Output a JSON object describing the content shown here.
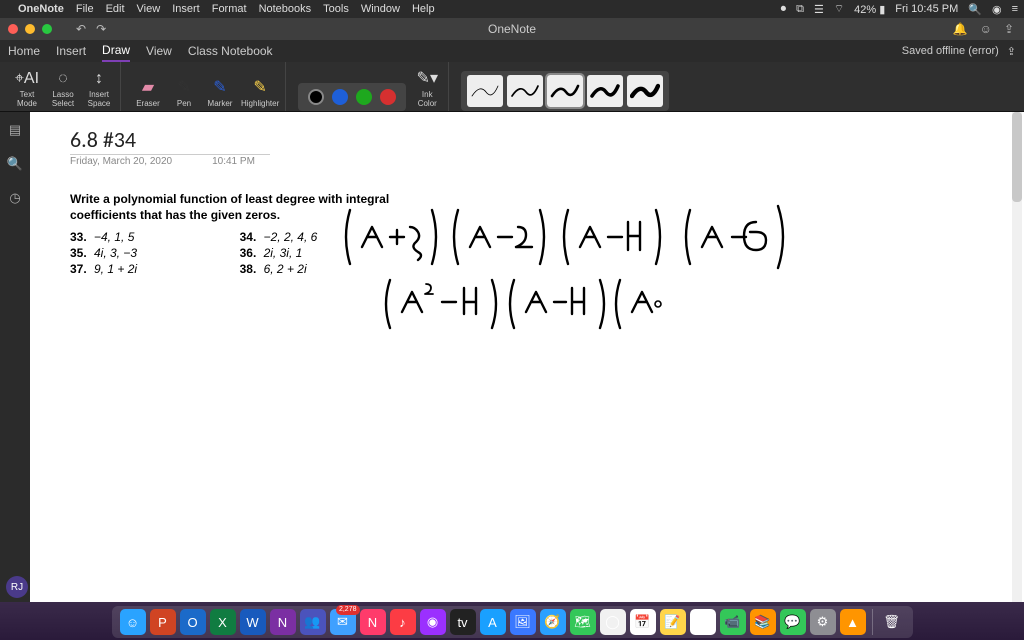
{
  "menubar": {
    "app": "OneNote",
    "items": [
      "File",
      "Edit",
      "View",
      "Insert",
      "Format",
      "Notebooks",
      "Tools",
      "Window",
      "Help"
    ],
    "status": {
      "battery": "42%",
      "clock": "Fri 10:45 PM"
    }
  },
  "titlebar": {
    "title": "OneNote",
    "undo": "↶",
    "redo": "↷",
    "bell": "🔔",
    "face": "☺",
    "share": "⇪"
  },
  "ribbon_tabs": [
    "Home",
    "Insert",
    "Draw",
    "View",
    "Class Notebook"
  ],
  "ribbon_active": "Draw",
  "save_status": "Saved offline (error)",
  "tools": {
    "text_mode": "Text\nMode",
    "lasso": "Lasso\nSelect",
    "insert_space": "Insert\nSpace",
    "eraser": "Eraser",
    "pen": "Pen",
    "marker": "Marker",
    "highlighter": "Highlighter",
    "ink_color": "Ink\nColor"
  },
  "colors": {
    "black": "#000000",
    "blue": "#1e5fd8",
    "green": "#1ea81e",
    "red": "#d63030"
  },
  "strokes": [
    "0.25 mm",
    "0.35 mm",
    "0.5 mm",
    "0.7 mm",
    "1 mm"
  ],
  "stroke_selected": 2,
  "page": {
    "title": "6.8 #34",
    "date": "Friday, March 20, 2020",
    "time": "10:41 PM",
    "stem": "Write a polynomial function of least degree with integral coefficients that has the given zeros.",
    "items_left": [
      {
        "n": "33.",
        "v": "−4, 1, 5"
      },
      {
        "n": "35.",
        "v": "4i, 3, −3"
      },
      {
        "n": "37.",
        "v": "9, 1 + 2i"
      }
    ],
    "items_right": [
      {
        "n": "34.",
        "v": "−2, 2, 4, 6"
      },
      {
        "n": "36.",
        "v": "2i, 3i, 1"
      },
      {
        "n": "38.",
        "v": "6, 2 + 2i"
      }
    ],
    "ink_line1": "( x + 2 ) ( x − 2 ) ( x − 4 ) ( x − 6 )",
    "ink_line2": "( x² − 4 ) ( x − 4 ) ( x"
  },
  "avatar": "RJ",
  "dock": {
    "apps": [
      {
        "name": "finder",
        "color": "#2aa3ff",
        "glyph": "☺"
      },
      {
        "name": "powerpoint",
        "color": "#d04423",
        "glyph": "P"
      },
      {
        "name": "outlook",
        "color": "#1b6ac9",
        "glyph": "O"
      },
      {
        "name": "excel",
        "color": "#107c41",
        "glyph": "X"
      },
      {
        "name": "word",
        "color": "#185abd",
        "glyph": "W"
      },
      {
        "name": "onenote",
        "color": "#7b2fa3",
        "glyph": "N"
      },
      {
        "name": "teams",
        "color": "#4b53bc",
        "glyph": "👥"
      },
      {
        "name": "mail",
        "color": "#3fa0ff",
        "glyph": "✉",
        "badge": "2,278"
      },
      {
        "name": "news",
        "color": "#ff3b6b",
        "glyph": "N"
      },
      {
        "name": "music",
        "color": "#fc3c44",
        "glyph": "♪"
      },
      {
        "name": "podcasts",
        "color": "#9b30ff",
        "glyph": "◉"
      },
      {
        "name": "tv",
        "color": "#222",
        "glyph": "tv"
      },
      {
        "name": "appstore",
        "color": "#1aa0ff",
        "glyph": "A"
      },
      {
        "name": "preview",
        "color": "#3a78ff",
        "glyph": "🖼"
      },
      {
        "name": "safari",
        "color": "#2aa0ff",
        "glyph": "🧭"
      },
      {
        "name": "maps",
        "color": "#34c759",
        "glyph": "🗺"
      },
      {
        "name": "chrome",
        "color": "#f1f1f1",
        "glyph": "◯"
      },
      {
        "name": "calendar",
        "color": "#fff",
        "glyph": "📅"
      },
      {
        "name": "notes",
        "color": "#ffd54a",
        "glyph": "📝"
      },
      {
        "name": "photos",
        "color": "#fff",
        "glyph": "🏞"
      },
      {
        "name": "facetime",
        "color": "#34c759",
        "glyph": "📹"
      },
      {
        "name": "books",
        "color": "#ff9500",
        "glyph": "📚"
      },
      {
        "name": "messages",
        "color": "#34c759",
        "glyph": "💬"
      },
      {
        "name": "preferences",
        "color": "#8e8e93",
        "glyph": "⚙"
      },
      {
        "name": "vlc",
        "color": "#ff9500",
        "glyph": "▲"
      }
    ],
    "trash": "🗑"
  }
}
